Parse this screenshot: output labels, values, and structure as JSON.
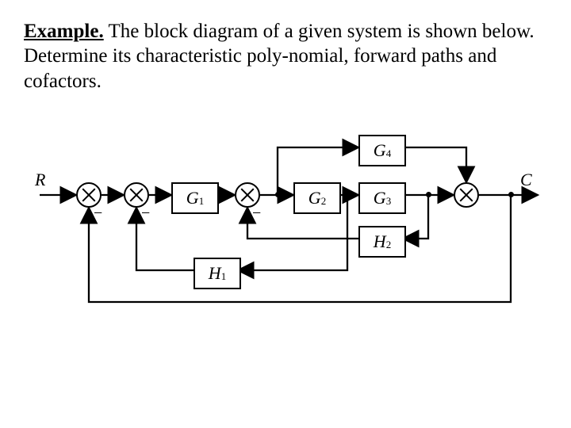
{
  "caption": {
    "lead": "Example.",
    "rest": " The block diagram of a given system is shown below. Determine its characteristic poly-nomial, forward paths and cofactors."
  },
  "labels": {
    "R": "R",
    "C": "C",
    "minus": "−"
  },
  "blocks": {
    "G1": {
      "sym": "G",
      "sub": "1"
    },
    "G2": {
      "sym": "G",
      "sub": "2"
    },
    "G3": {
      "sym": "G",
      "sub": "3"
    },
    "G4": {
      "sym": "G",
      "sub": "4"
    },
    "H1": {
      "sym": "H",
      "sub": "1"
    },
    "H2": {
      "sym": "H",
      "sub": "2"
    }
  }
}
